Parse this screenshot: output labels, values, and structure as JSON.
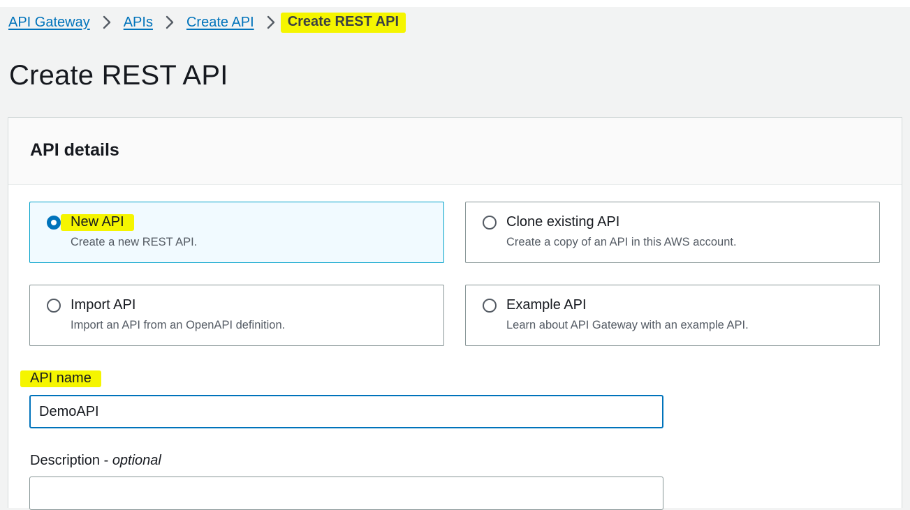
{
  "breadcrumb": {
    "items": [
      "API Gateway",
      "APIs",
      "Create API"
    ],
    "current": "Create REST API",
    "separator_icon": "chevron-right-icon"
  },
  "page": {
    "title": "Create REST API"
  },
  "api_details": {
    "title": "API details",
    "options": [
      {
        "label": "New API",
        "description": "Create a new REST API.",
        "selected": true
      },
      {
        "label": "Clone existing API",
        "description": "Create a copy of an API in this AWS account.",
        "selected": false
      },
      {
        "label": "Import API",
        "description": "Import an API from an OpenAPI definition.",
        "selected": false
      },
      {
        "label": "Example API",
        "description": "Learn about API Gateway with an example API.",
        "selected": false
      }
    ],
    "api_name": {
      "label": "API name",
      "value": "DemoAPI"
    },
    "description": {
      "label": "Description - ",
      "label_optional": "optional",
      "value": ""
    }
  },
  "colors": {
    "link": "#0073bb",
    "highlight": "#f5f500",
    "selected_border": "#00a1c9",
    "selected_bg": "#f1faff",
    "page_bg": "#f2f3f3"
  }
}
